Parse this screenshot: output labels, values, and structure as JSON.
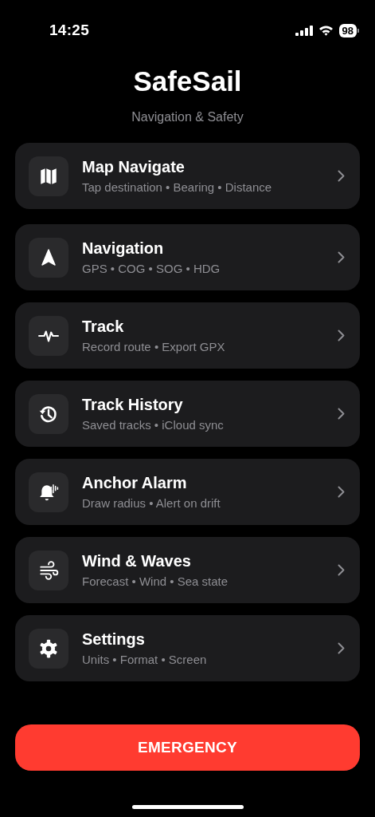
{
  "status_bar": {
    "time": "14:25",
    "battery": "98"
  },
  "header": {
    "title": "SafeSail",
    "subtitle": "Navigation & Safety"
  },
  "featured": [
    {
      "title": "Map Navigate",
      "subtitle": "Tap destination • Bearing • Distance"
    }
  ],
  "items": [
    {
      "title": "Navigation",
      "subtitle": "GPS • COG • SOG • HDG"
    },
    {
      "title": "Track",
      "subtitle": "Record route • Export GPX"
    },
    {
      "title": "Track History",
      "subtitle": "Saved tracks • iCloud sync"
    },
    {
      "title": "Anchor Alarm",
      "subtitle": "Draw radius • Alert on drift"
    },
    {
      "title": "Wind & Waves",
      "subtitle": "Forecast • Wind • Sea state"
    },
    {
      "title": "Settings",
      "subtitle": "Units • Format • Screen"
    }
  ],
  "emergency_button": {
    "label": "EMERGENCY"
  }
}
